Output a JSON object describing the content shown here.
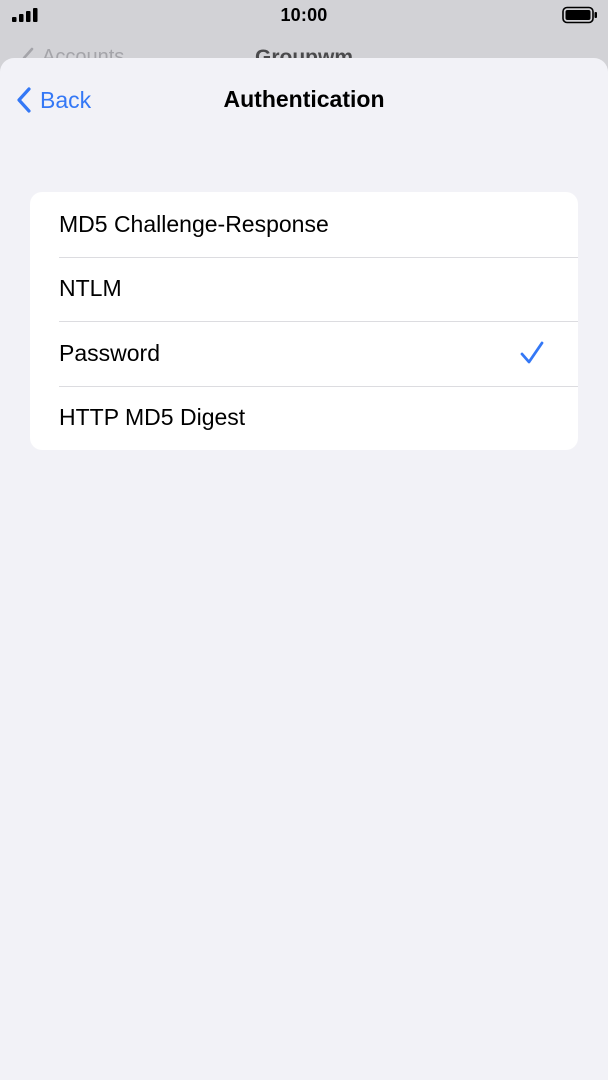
{
  "status_bar": {
    "time": "10:00",
    "signal_icon": "cellular-signal-icon",
    "battery_icon": "battery-full-icon"
  },
  "underlying_nav": {
    "back_label": "Accounts",
    "title": "Groupwm"
  },
  "nav": {
    "back_label": "Back",
    "title": "Authentication",
    "back_icon": "chevron-left-icon"
  },
  "options": [
    {
      "label": "MD5 Challenge-Response",
      "selected": false
    },
    {
      "label": "NTLM",
      "selected": false
    },
    {
      "label": "Password",
      "selected": true
    },
    {
      "label": "HTTP MD5 Digest",
      "selected": false
    }
  ],
  "colors": {
    "accent": "#3478f6",
    "sheet_background": "#f2f2f7",
    "group_background": "#ffffff"
  }
}
